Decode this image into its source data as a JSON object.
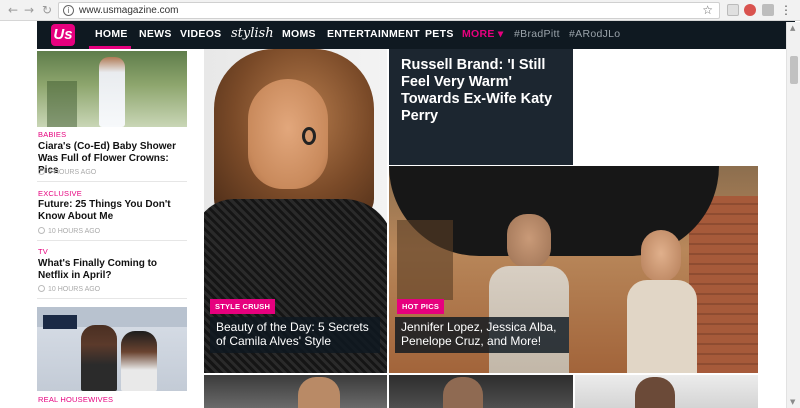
{
  "browser": {
    "url": "www.usmagazine.com",
    "back_icon": "←",
    "forward_icon": "→",
    "reload_icon": "↻",
    "menu_icon": "⋮"
  },
  "nav": {
    "logo": "Us",
    "items": [
      "HOME",
      "NEWS",
      "VIDEOS",
      "stylish",
      "MOMS",
      "ENTERTAINMENT",
      "PETS"
    ],
    "more": "MORE ▾",
    "tags": [
      "#BradPitt",
      "#ARodJLo"
    ]
  },
  "sidebar": {
    "stories": [
      {
        "category": "BABIES",
        "headline": "Ciara's (Co-Ed) Baby Shower Was Full of Flower Crowns: Pics",
        "time": "9 HOURS AGO"
      },
      {
        "category": "EXCLUSIVE",
        "headline": "Future: 25 Things You Don't Know About Me",
        "time": "10 HOURS AGO"
      },
      {
        "category": "TV",
        "headline": "What's Finally Coming to Netflix in April?",
        "time": "10 HOURS AGO"
      },
      {
        "category": "REAL HOUSEWIVES",
        "headline": "",
        "time": ""
      }
    ]
  },
  "main": {
    "feature_left": {
      "badge": "STYLE CRUSH",
      "headline": "Beauty of the Day: 5 Secrets of Camila Alves' Style"
    },
    "feature_top": {
      "headline": "Russell Brand: 'I Still Feel Very Warm' Towards Ex-Wife Katy Perry"
    },
    "feature_right": {
      "badge": "HOT PICS",
      "headline": "Jennifer Lopez, Jessica Alba, Penelope Cruz, and More!"
    }
  },
  "colors": {
    "accent": "#e6007e",
    "nav_bg": "#0f1921"
  }
}
